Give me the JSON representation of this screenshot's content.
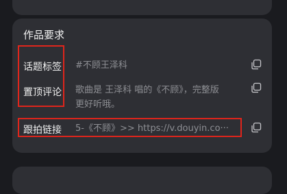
{
  "section": {
    "title": "作品要求"
  },
  "rows": [
    {
      "label": "话题标签",
      "value": "#不顾王泽科"
    },
    {
      "label": "置顶评论",
      "value_line1": "歌曲是 王泽科 唱的《不顾》，完整版",
      "value_line2": "更好听哦。"
    },
    {
      "label": "跟拍链接",
      "value": "5-《不顾》>> https://v.douyin.co···"
    }
  ],
  "icons": {
    "copy": "copy-icon"
  },
  "colors": {
    "card": "#2e2f34",
    "background": "#1a1b1f",
    "highlight": "#e1251b",
    "label": "#f0f0f0",
    "value": "#8e8f94"
  }
}
